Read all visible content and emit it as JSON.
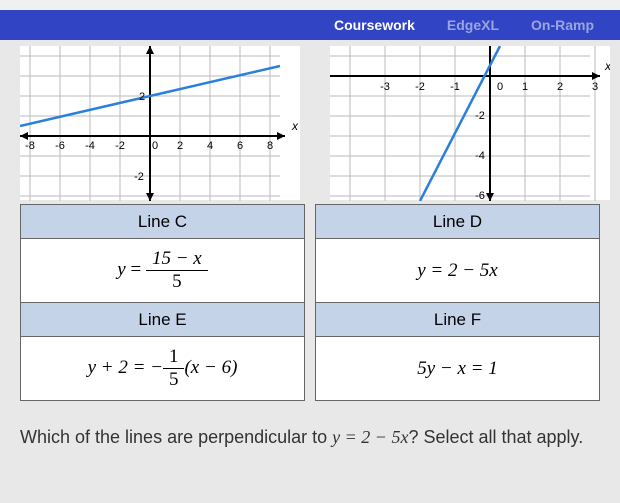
{
  "nav": {
    "tab1": "Coursework",
    "tab2": "EdgeXL",
    "tab3": "On-Ramp"
  },
  "graphs": {
    "left": {
      "axis_label": "x",
      "x_ticks": [
        "-8",
        "-6",
        "-4",
        "-2",
        "0",
        "2",
        "4",
        "6",
        "8"
      ],
      "y_ticks_pos": [
        "2"
      ],
      "y_ticks_neg": [
        "-2"
      ]
    },
    "right": {
      "axis_label": "x",
      "x_ticks": [
        "-3",
        "-2",
        "-1",
        "0",
        "1",
        "2",
        "3"
      ],
      "y_ticks_neg": [
        "-2",
        "-4",
        "-6"
      ]
    }
  },
  "table": {
    "lineC_label": "Line C",
    "lineD_label": "Line D",
    "lineE_label": "Line E",
    "lineF_label": "Line F",
    "lineC_eq_lhs": "y",
    "lineC_eq_eq": " = ",
    "lineC_eq_num": "15 − x",
    "lineC_eq_den": "5",
    "lineD_eq": "y = 2 − 5x",
    "lineE_eq_lhs": "y + 2 = −",
    "lineE_eq_num": "1",
    "lineE_eq_den": "5",
    "lineE_eq_rhs": "(x − 6)",
    "lineF_eq": "5y − x = 1"
  },
  "question": {
    "p1": "Which of the lines are perpendicular to ",
    "eq": "y = 2 − 5x",
    "p2": "? Select all that apply."
  },
  "chart_data": [
    {
      "type": "line",
      "title": "",
      "xlabel": "x",
      "ylabel": "",
      "xlim": [
        -8,
        8
      ],
      "ylim": [
        -3,
        4
      ],
      "x_ticks": [
        -8,
        -6,
        -4,
        -2,
        0,
        2,
        4,
        6,
        8
      ],
      "y_ticks": [
        -2,
        2
      ],
      "series": [
        {
          "name": "line",
          "x": [
            -8,
            8
          ],
          "y": [
            0.8,
            4
          ]
        }
      ]
    },
    {
      "type": "line",
      "title": "",
      "xlabel": "x",
      "ylabel": "",
      "xlim": [
        -3.5,
        3.5
      ],
      "ylim": [
        -7,
        1
      ],
      "x_ticks": [
        -3,
        -2,
        -1,
        0,
        1,
        2,
        3
      ],
      "y_ticks": [
        -2,
        -4,
        -6
      ],
      "series": [
        {
          "name": "line",
          "x": [
            -2,
            0.3
          ],
          "y": [
            -7,
            1
          ]
        }
      ]
    }
  ]
}
